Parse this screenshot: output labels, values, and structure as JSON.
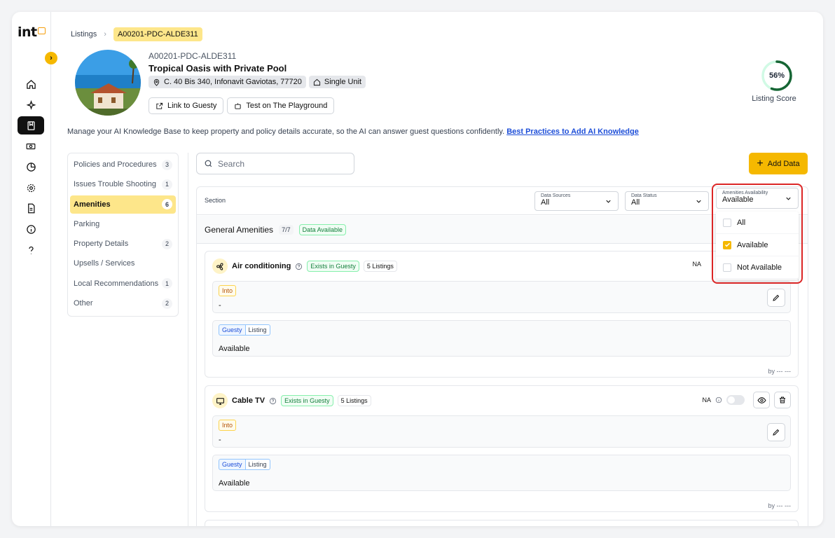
{
  "app": {
    "logo_text": "int"
  },
  "breadcrumb": {
    "root": "Listings",
    "current": "A00201-PDC-ALDE311"
  },
  "listing": {
    "id": "A00201-PDC-ALDE311",
    "title": "Tropical Oasis with Private Pool",
    "address": "C. 40 Bis 340, Infonavit Gaviotas, 77720",
    "unit_type": "Single Unit",
    "link_button": "Link to Guesty",
    "test_button": "Test on The Playground",
    "score": "56%",
    "score_value": 0.56,
    "score_label": "Listing Score"
  },
  "description": {
    "text": "Manage your AI Knowledge Base to keep property and policy details accurate, so the AI can answer guest questions confidently.",
    "link": "Best Practices to Add AI Knowledge"
  },
  "sections": [
    {
      "label": "Policies and Procedures",
      "count": "3"
    },
    {
      "label": "Issues Trouble Shooting",
      "count": "1"
    },
    {
      "label": "Amenities",
      "count": "6",
      "active": true
    },
    {
      "label": "Parking",
      "count": ""
    },
    {
      "label": "Property Details",
      "count": "2"
    },
    {
      "label": "Upsells / Services",
      "count": ""
    },
    {
      "label": "Local Recommendations",
      "count": "1"
    },
    {
      "label": "Other",
      "count": "2"
    }
  ],
  "search": {
    "placeholder": "Search"
  },
  "add_button": "Add Data",
  "panel": {
    "section_label": "Section",
    "filters": [
      {
        "label": "Data Sources",
        "value": "All"
      },
      {
        "label": "Data Status",
        "value": "All"
      },
      {
        "label": "Amenities Availability",
        "value": "Available"
      }
    ],
    "dropdown_options": [
      {
        "label": "All",
        "checked": false
      },
      {
        "label": "Available",
        "checked": true
      },
      {
        "label": "Not Available",
        "checked": false
      }
    ],
    "group": {
      "title": "General Amenities",
      "count": "7/7",
      "status": "Data Available"
    },
    "cards": [
      {
        "name": "Air conditioning",
        "guesty": "Exists in Guesty",
        "listings": "5 Listings",
        "na": "NA",
        "into_tag": "Into",
        "into_value": "-",
        "tag_a": "Guesty",
        "tag_b": "Listing",
        "source_value": "Available",
        "byline": "by --- ---"
      },
      {
        "name": "Cable TV",
        "guesty": "Exists in Guesty",
        "listings": "5 Listings",
        "na": "NA",
        "into_tag": "Into",
        "into_value": "-",
        "tag_a": "Guesty",
        "tag_b": "Listing",
        "source_value": "Available",
        "byline": "by --- ---"
      }
    ]
  },
  "colors": {
    "accent": "#f5b800",
    "highlight": "#dc2626",
    "active_bg": "#fde68a"
  }
}
